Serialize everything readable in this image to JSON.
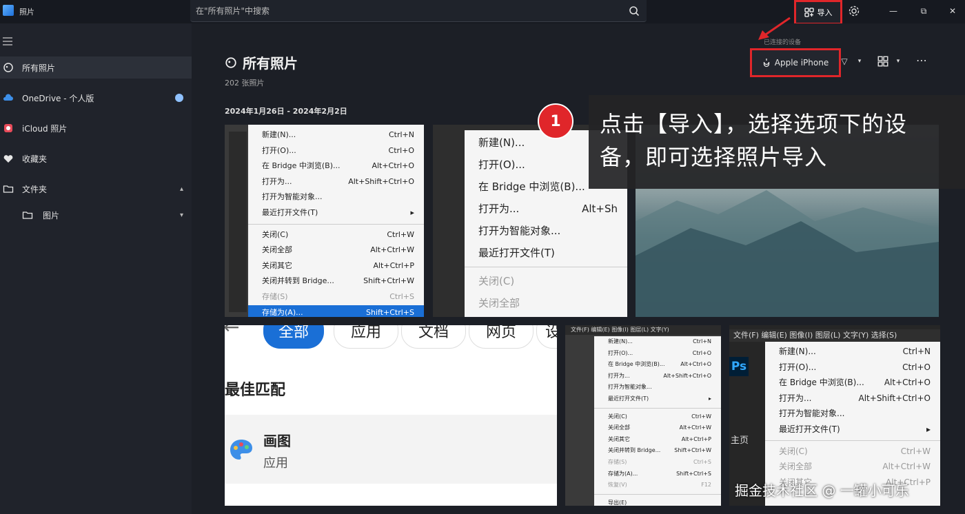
{
  "app": {
    "title": "照片"
  },
  "search": {
    "placeholder": "在\"所有照片\"中搜索"
  },
  "titlebar": {
    "import_label": "导入"
  },
  "sidebar": {
    "items": [
      {
        "label": "所有照片",
        "icon": "photos-icon"
      },
      {
        "label": "OneDrive - 个人版",
        "icon": "cloud-icon"
      },
      {
        "label": "iCloud 照片",
        "icon": "icloud-icon"
      },
      {
        "label": "收藏夹",
        "icon": "heart-icon"
      },
      {
        "label": "文件夹",
        "icon": "folder-icon"
      },
      {
        "label": "图片",
        "icon": "folder-icon"
      }
    ]
  },
  "main": {
    "title": "所有照片",
    "count": "202 张照片",
    "date_range": "2024年1月26日 - 2024年2月2日",
    "device_caption": "已连接的设备",
    "device_label": "Apple iPhone"
  },
  "photo1": {
    "rows": [
      {
        "l": "新建(N)...",
        "r": "Ctrl+N"
      },
      {
        "l": "打开(O)...",
        "r": "Ctrl+O"
      },
      {
        "l": "在 Bridge 中浏览(B)...",
        "r": "Alt+Ctrl+O"
      },
      {
        "l": "打开为...",
        "r": "Alt+Shift+Ctrl+O"
      },
      {
        "l": "打开为智能对象...",
        "r": ""
      },
      {
        "l": "最近打开文件(T)",
        "r": "▸"
      },
      {
        "l": "关闭(C)",
        "r": "Ctrl+W"
      },
      {
        "l": "关闭全部",
        "r": "Alt+Ctrl+W"
      },
      {
        "l": "关闭其它",
        "r": "Alt+Ctrl+P"
      },
      {
        "l": "关闭并转到 Bridge...",
        "r": "Shift+Ctrl+W"
      },
      {
        "l": "存储(S)",
        "r": "Ctrl+S"
      },
      {
        "l": "存储为(A)...",
        "r": "Shift+Ctrl+S"
      }
    ]
  },
  "photo2": {
    "rows": [
      {
        "l": "新建(N)...",
        "r": ""
      },
      {
        "l": "打开(O)...",
        "r": ""
      },
      {
        "l": "在 Bridge 中浏览(B)...",
        "r": ""
      },
      {
        "l": "打开为...",
        "r": "Alt+Sh"
      },
      {
        "l": "打开为智能对象...",
        "r": ""
      },
      {
        "l": "最近打开文件(T)",
        "r": ""
      },
      {
        "l": "关闭(C)",
        "r": ""
      },
      {
        "l": "关闭全部",
        "r": ""
      }
    ]
  },
  "photo4": {
    "tabs": [
      "全部",
      "应用",
      "文档",
      "网页",
      "设"
    ],
    "heading": "最佳匹配",
    "app_name": "画图",
    "app_type": "应用"
  },
  "photo5": {
    "menubar": "文件(F) 编辑(E) 图像(I) 图层(L) 文字(Y)",
    "rows": [
      {
        "l": "新建(N)...",
        "r": "Ctrl+N"
      },
      {
        "l": "打开(O)...",
        "r": "Ctrl+O"
      },
      {
        "l": "在 Bridge 中浏览(B)...",
        "r": "Alt+Ctrl+O"
      },
      {
        "l": "打开为...",
        "r": "Alt+Shift+Ctrl+O"
      },
      {
        "l": "打开为智能对象...",
        "r": ""
      },
      {
        "l": "最近打开文件(T)",
        "r": "▸"
      },
      {
        "l": "关闭(C)",
        "r": "Ctrl+W"
      },
      {
        "l": "关闭全部",
        "r": "Alt+Ctrl+W"
      },
      {
        "l": "关闭其它",
        "r": "Alt+Ctrl+P"
      },
      {
        "l": "关闭并转到 Bridge...",
        "r": "Shift+Ctrl+W"
      },
      {
        "l": "存储(S)",
        "r": "Ctrl+S"
      },
      {
        "l": "存储为(A)...",
        "r": "Shift+Ctrl+S"
      },
      {
        "l": "恢复(V)",
        "r": "F12"
      },
      {
        "l": "导出(E)",
        "r": ""
      }
    ]
  },
  "photo6": {
    "menubar": "文件(F)  编辑(E)  图像(I)  图层(L)  文字(Y)  选择(S)",
    "ps_logo": "Ps",
    "side_label": "主页",
    "rows": [
      {
        "l": "新建(N)...",
        "r": "Ctrl+N"
      },
      {
        "l": "打开(O)...",
        "r": "Ctrl+O"
      },
      {
        "l": "在 Bridge 中浏览(B)...",
        "r": "Alt+Ctrl+O"
      },
      {
        "l": "打开为...",
        "r": "Alt+Shift+Ctrl+O"
      },
      {
        "l": "打开为智能对象...",
        "r": ""
      },
      {
        "l": "最近打开文件(T)",
        "r": "▸"
      },
      {
        "l": "关闭(C)",
        "r": "Ctrl+W"
      },
      {
        "l": "关闭全部",
        "r": "Alt+Ctrl+W"
      },
      {
        "l": "关闭其它",
        "r": "Alt+Ctrl+P"
      }
    ]
  },
  "overlay": {
    "step": "1",
    "instruction": "点击【导入】，选择选项下的设备，即可选择照片导入",
    "watermark": "掘金技术社区 @ 一罐小可乐"
  },
  "colors": {
    "highlight": "#e0262a",
    "accent": "#1a6fd6",
    "background": "#1c1f26"
  }
}
